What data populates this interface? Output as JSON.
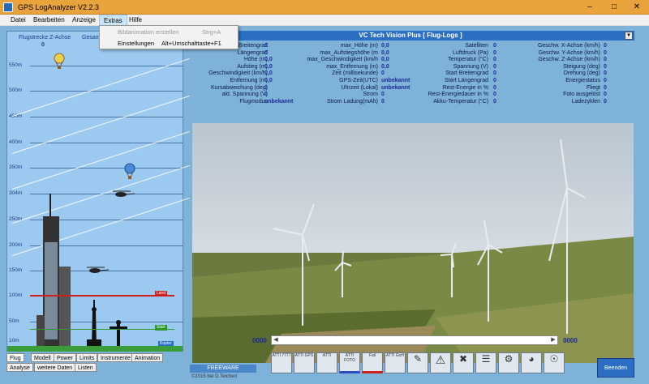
{
  "window": {
    "title": "GPS LogAnalyzer V2.2.3"
  },
  "menu": {
    "items": [
      "Datei",
      "Bearbeiten",
      "Anzeige",
      "Extras",
      "Hilfe"
    ]
  },
  "extras_menu": {
    "items": [
      {
        "label": "Bildanimation erstellen",
        "shortcut": "Strg+A",
        "disabled": true
      },
      {
        "label": "Einstellungen",
        "shortcut": "Alt+Umschalttaste+F1",
        "disabled": false
      }
    ]
  },
  "left": {
    "header_left": "Flugstrecke Z-Achse",
    "header_right": "Gesam",
    "header_value": "0",
    "altitudes": [
      "550m",
      "500m",
      "450m",
      "400m",
      "350m",
      "304m",
      "250m",
      "200m",
      "150m",
      "100m",
      "50m",
      "10m"
    ],
    "red_tag": "Land",
    "green_tag": "Start",
    "blue_tag": "Kopter",
    "tabs": [
      "Flug",
      "Modell",
      "Power",
      "Limits",
      "Instrumente",
      "Animation",
      "Analyse",
      "weitere Daten",
      "Listen"
    ]
  },
  "main": {
    "title": "VC Tech Vision Plus [ Flug-Logs ]",
    "col1": [
      {
        "label": "Breitengrad",
        "value": "0"
      },
      {
        "label": "Längengrad",
        "value": "0"
      },
      {
        "label": "Höhe (m)",
        "value": "0,0"
      },
      {
        "label": "Aufstieg (m)",
        "value": "0,0"
      },
      {
        "label": "Geschwindigkeit (km/h)",
        "value": "0,0"
      },
      {
        "label": "Entfernung (m)",
        "value": "0,0"
      },
      {
        "label": "Kursabweichung (deg)",
        "value": "0"
      },
      {
        "label": "akt. Spannung (V)",
        "value": "0"
      },
      {
        "label": "Flugmodus",
        "value": "unbekannt"
      }
    ],
    "col2": [
      {
        "label": "max_Höhe (m)",
        "value": "0,0"
      },
      {
        "label": "max_Aufstiegshöhe (m",
        "value": "0,0"
      },
      {
        "label": "max_Geschwindigkeit (km/h",
        "value": "0,0"
      },
      {
        "label": "max_Entfernung (m)",
        "value": "0,0"
      },
      {
        "label": "Zeit (millisekunde)",
        "value": "0"
      },
      {
        "label": "GPS-Zeit(UTC)",
        "value": "unbekannt"
      },
      {
        "label": "Uhrzeit (Lokal)",
        "value": "unbekannt"
      },
      {
        "label": "Strom",
        "value": "0"
      },
      {
        "label": "Strom Ladung(mAh)",
        "value": "0"
      }
    ],
    "col3": [
      {
        "label": "Satelliten",
        "value": "0"
      },
      {
        "label": "Luftdruck (Pa)",
        "value": "0"
      },
      {
        "label": "Temperatur (°C)",
        "value": "0"
      },
      {
        "label": "Spannung (V)",
        "value": "0"
      },
      {
        "label": "Start Breitengrad",
        "value": "0"
      },
      {
        "label": "Start Längengrad",
        "value": "0"
      },
      {
        "label": "Rest-Energie in %",
        "value": "0"
      },
      {
        "label": "Rest-Energiedauer in %",
        "value": "0"
      },
      {
        "label": "Akku-Temperatur (°C)",
        "value": "0"
      }
    ],
    "col4": [
      {
        "label": "Geschw. X-Achse (km/h)",
        "value": "0"
      },
      {
        "label": "Geschw. Y-Achse (km/h)",
        "value": "0"
      },
      {
        "label": "Geschw. Z-Achse (km/h)",
        "value": "0"
      },
      {
        "label": "Steigung (deg)",
        "value": "0"
      },
      {
        "label": "Drehung (deg)",
        "value": "0"
      },
      {
        "label": "Energiestatus",
        "value": "0"
      },
      {
        "label": "Fliegt",
        "value": "0"
      },
      {
        "label": "Foto ausgelöst",
        "value": "0"
      },
      {
        "label": "Ladezyklen",
        "value": "0"
      }
    ],
    "time_left": "0000",
    "time_right": "0000",
    "freeware": "FREEWARE",
    "copyright": "©2015  bei D.Teichert",
    "quit_label": "Beenden",
    "icon_buttons": [
      "ATTI 7777",
      "ATTI GPS",
      "ATTI",
      "ATTI FOTO",
      "Fail",
      "ATTI GoH",
      "",
      "",
      "",
      "",
      "",
      "",
      ""
    ]
  }
}
